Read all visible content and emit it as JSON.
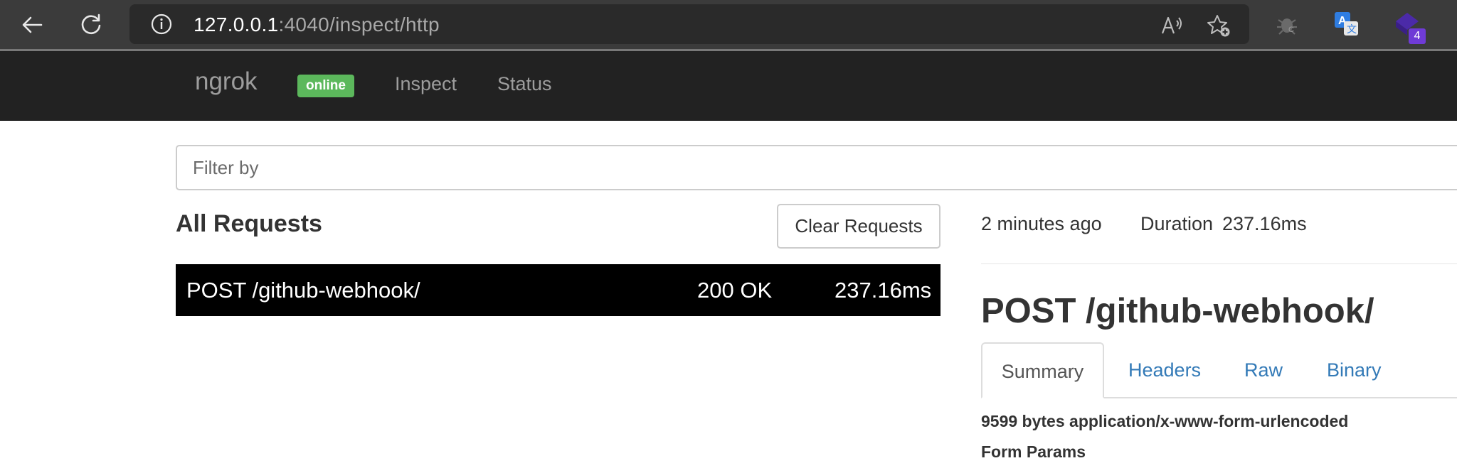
{
  "browser": {
    "url_host": "127.0.0.1",
    "url_path": ":4040/inspect/http",
    "extension_badge": "4",
    "colors": {
      "chrome_bg": "#3b3b3b",
      "address_bg": "#2a2a2a"
    },
    "icons": [
      "back-arrow-icon",
      "reload-icon",
      "info-icon",
      "read-aloud-icon",
      "favorite-add-icon",
      "bug-extension-icon",
      "translate-extension-icon",
      "purple-extension-icon"
    ]
  },
  "navbar": {
    "brand": "ngrok",
    "status_badge": "online",
    "links": [
      "Inspect",
      "Status"
    ],
    "colors": {
      "bg": "#222222",
      "badge": "#5cb85c"
    }
  },
  "filter": {
    "placeholder": "Filter by"
  },
  "requests_panel": {
    "title": "All Requests",
    "clear_button": "Clear Requests",
    "rows": [
      {
        "method_path": "POST /github-webhook/",
        "status": "200 OK",
        "duration": "237.16ms"
      }
    ]
  },
  "detail": {
    "time_ago": "2 minutes ago",
    "duration_label": "Duration",
    "duration_value": "237.16ms",
    "title": "POST /github-webhook/",
    "tabs": [
      "Summary",
      "Headers",
      "Raw",
      "Binary"
    ],
    "active_tab": "Summary",
    "summary_line": "9599 bytes application/x-www-form-urlencoded",
    "section_heading": "Form Params",
    "colors": {
      "link": "#337ab7"
    }
  }
}
